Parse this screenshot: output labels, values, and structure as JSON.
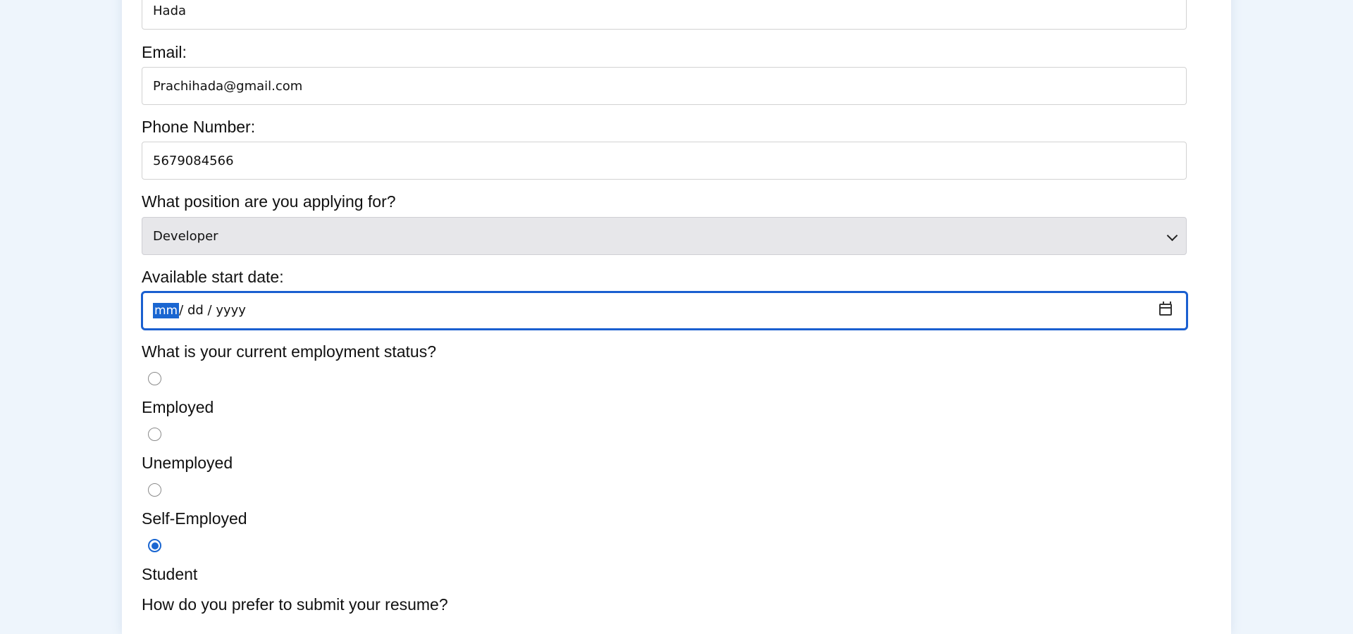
{
  "form": {
    "last_name_value": "Hada",
    "email": {
      "label": "Email:",
      "value": "Prachihada@gmail.com"
    },
    "phone": {
      "label": "Phone Number:",
      "value": "5679084566"
    },
    "position": {
      "label": "What position are you applying for?",
      "selected": "Developer"
    },
    "start_date": {
      "label": "Available start date:",
      "mm": "mm",
      "sep1": "/",
      "dd": "dd",
      "sep2": "/",
      "yyyy": "yyyy"
    },
    "employment": {
      "label": "What is your current employment status?",
      "options": [
        {
          "label": "Employed",
          "checked": false
        },
        {
          "label": "Unemployed",
          "checked": false
        },
        {
          "label": "Self-Employed",
          "checked": false
        },
        {
          "label": "Student",
          "checked": true
        }
      ]
    },
    "resume": {
      "label": "How do you prefer to submit your resume?"
    }
  },
  "colors": {
    "page_background": "#eef5fc",
    "focus_border": "#1a5fd0",
    "radio_checked": "#1a66d1",
    "select_background": "#e7e7ea"
  },
  "icons": {
    "date_picker": "calendar-icon",
    "select": "chevron-down-icon"
  }
}
